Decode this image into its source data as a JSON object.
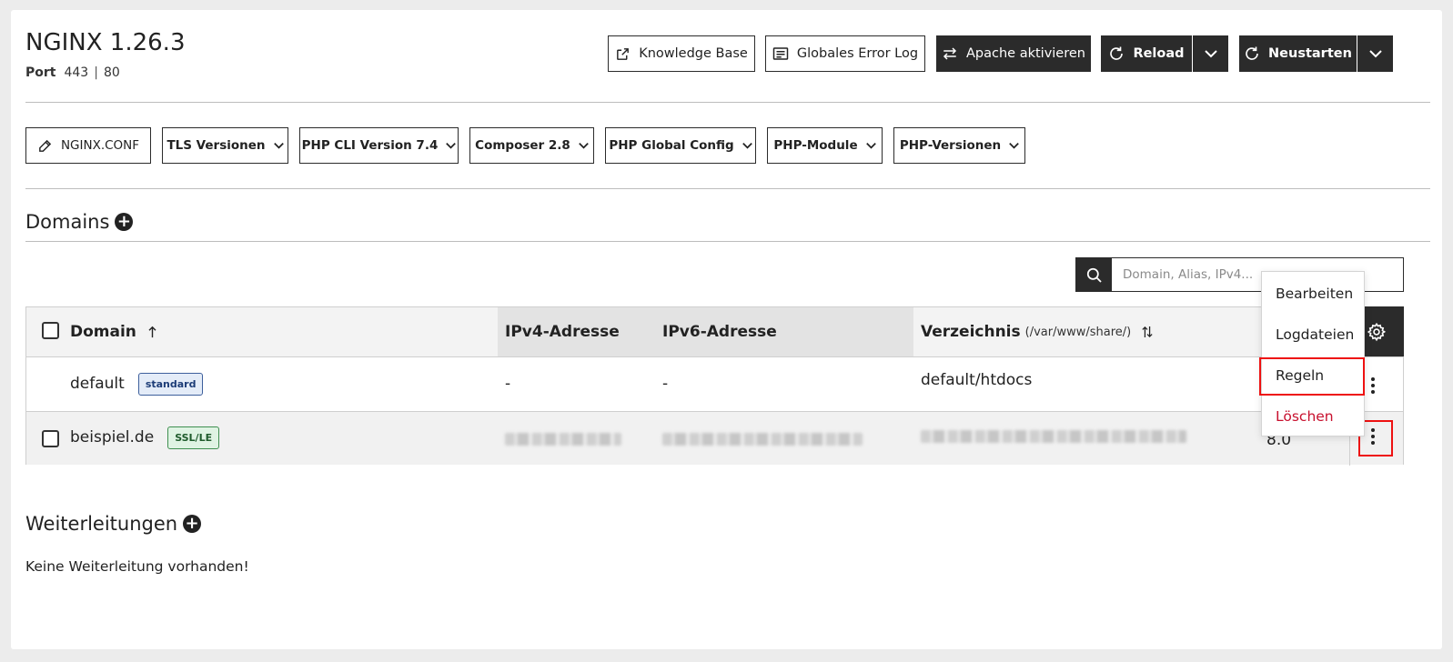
{
  "header": {
    "title": "NGINX 1.26.3",
    "port_label": "Port",
    "port_https": "443",
    "port_http": "80"
  },
  "toolbar": {
    "knowledge_base": "Knowledge Base",
    "error_log": "Globales Error Log",
    "apache": "Apache aktivieren",
    "reload": "Reload",
    "restart": "Neustarten"
  },
  "config_bar": {
    "nginx_conf": "NGINX.CONF",
    "tls": "TLS Versionen",
    "php_cli": "PHP CLI Version 7.4",
    "composer": "Composer 2.8",
    "php_global": "PHP Global Config",
    "php_modules": "PHP-Module",
    "php_versions": "PHP-Versionen"
  },
  "domains": {
    "title": "Domains",
    "search_placeholder": "Domain, Alias, IPv4...",
    "columns": {
      "domain": "Domain",
      "ipv4": "IPv4-Adresse",
      "ipv6": "IPv6-Adresse",
      "directory": "Verzeichnis",
      "directory_hint": "(/var/www/share/)"
    },
    "rows": [
      {
        "domain": "default",
        "badge": "standard",
        "ipv4": "-",
        "ipv6": "-",
        "directory": "default/htdocs",
        "php": ""
      },
      {
        "domain": "beispiel.de",
        "badge": "SSL/LE",
        "ipv4": "",
        "ipv6": "",
        "directory": "",
        "php": "8.0"
      }
    ]
  },
  "context_menu": {
    "edit": "Bearbeiten",
    "logs": "Logdateien",
    "rules": "Regeln",
    "delete": "Löschen"
  },
  "redirects": {
    "title": "Weiterleitungen",
    "empty": "Keine Weiterleitung vorhanden!"
  },
  "colors": {
    "dark": "#2b2b2b",
    "danger": "#c8102e",
    "highlight": "#e11111"
  }
}
